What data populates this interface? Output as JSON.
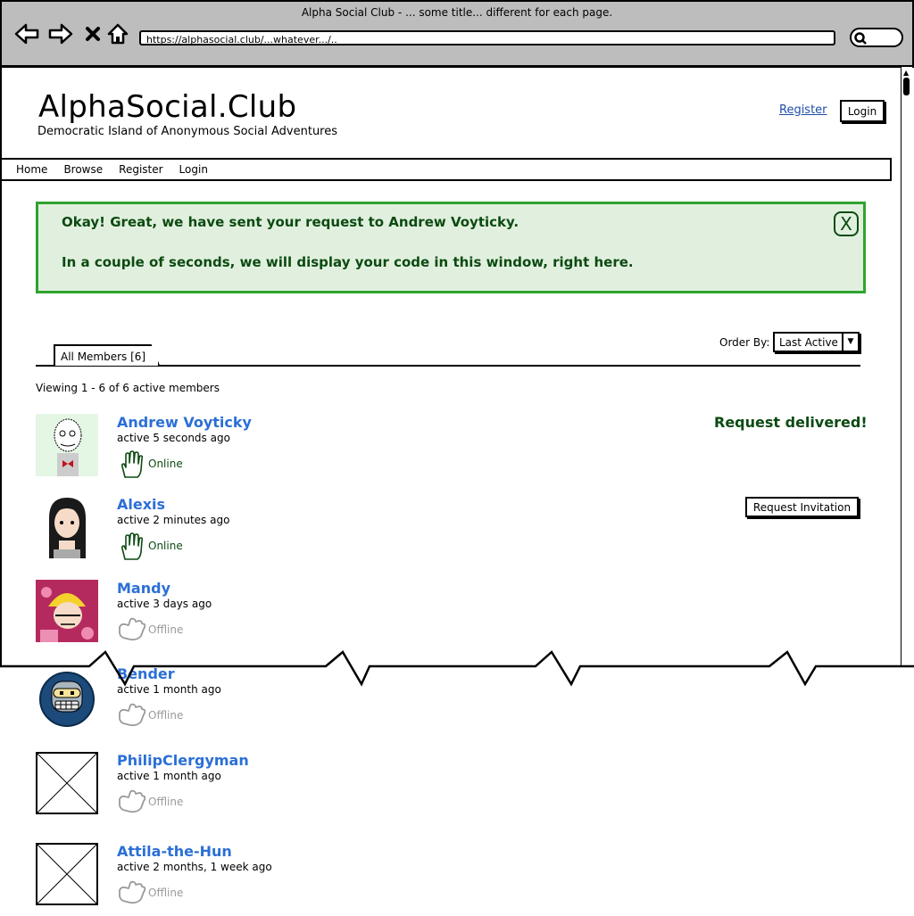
{
  "browser": {
    "title": "Alpha Social Club - ... some title... different for each page.",
    "url": "https://alphasocial.club/...whatever.../..",
    "nav_icons": [
      "back-arrow-icon",
      "forward-arrow-icon",
      "stop-icon",
      "home-icon"
    ],
    "search_icon": "search-icon"
  },
  "site": {
    "brand": "AlphaSocial.Club",
    "tagline": "Democratic Island of Anonymous Social Adventures",
    "register_link": "Register",
    "login_button": "Login"
  },
  "nav": {
    "items": [
      "Home",
      "Browse",
      "Register",
      "Login"
    ]
  },
  "alert": {
    "line1": "Okay! Great, we have sent your request to Andrew Voyticky.",
    "line2": "In a couple of seconds, we will display your code in this window, right here.",
    "close": "X"
  },
  "members_panel": {
    "order_by_label": "Order By:",
    "order_by_value": "Last Active",
    "tab_label": "All Members [6]",
    "viewing_text": "Viewing 1 - 6 of 6 active members"
  },
  "members": [
    {
      "name": "Andrew Voyticky",
      "active": "active 5 seconds ago",
      "status": "Online",
      "action": "Request delivered!"
    },
    {
      "name": "Alexis",
      "active": "active 2 minutes ago",
      "status": "Online",
      "action": "Request Invitation"
    },
    {
      "name": "Mandy",
      "active": "active 3 days ago",
      "status": "Offline"
    },
    {
      "name": "Bender",
      "active": "active 1 month ago",
      "status": "Offline"
    },
    {
      "name": "PhilipClergyman",
      "active": "active 1 month ago",
      "status": "Offline"
    },
    {
      "name": "Attila-the-Hun",
      "active": "active 2 months, 1 week ago",
      "status": "Offline"
    }
  ],
  "colors": {
    "alert_bg": "#e1f0de",
    "alert_border": "#2ea42e",
    "alert_text": "#0c4a12",
    "member_link": "#2b6fd6",
    "offline": "#9a9a9a",
    "chrome": "#bdbdbd"
  }
}
